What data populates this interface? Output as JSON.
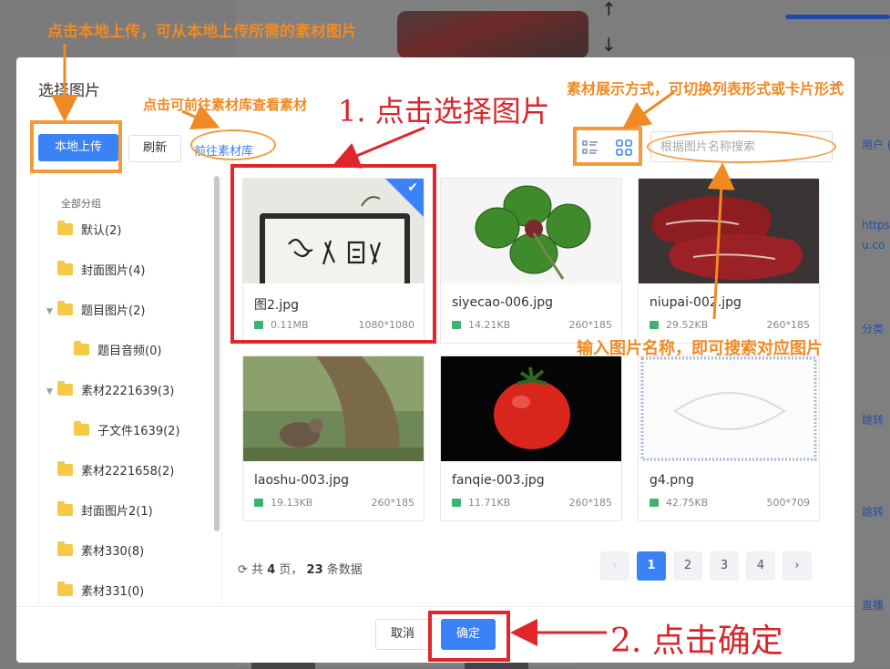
{
  "background": {
    "side_items": [
      "用户 (",
      "https",
      "u.co",
      "分类",
      "跳转",
      "跳转",
      "直播"
    ]
  },
  "modal": {
    "title": "选择图片",
    "close": "×",
    "upload_label": "本地上传",
    "refresh_label": "刷新",
    "library_link": "前往素材库",
    "search_placeholder": "根据图片名称搜索",
    "search_value": "",
    "sidebar": {
      "heading": "全部分组",
      "items": [
        {
          "label": "默认(2)"
        },
        {
          "label": "封面图片(4)"
        },
        {
          "label": "题目图片(2)"
        },
        {
          "label": "题目音频(0)"
        },
        {
          "label": "素材2221639(3)"
        },
        {
          "label": "子文件1639(2)"
        },
        {
          "label": "素材2221658(2)"
        },
        {
          "label": "封面图片2(1)"
        },
        {
          "label": "素材330(8)"
        },
        {
          "label": "素材331(0)"
        }
      ]
    },
    "images": [
      {
        "name": "图2.jpg",
        "size": "0.11MB",
        "dims": "1080*1080",
        "selected": true
      },
      {
        "name": "siyecao-006.jpg",
        "size": "14.21KB",
        "dims": "260*185",
        "selected": false
      },
      {
        "name": "niupai-002.jpg",
        "size": "29.52KB",
        "dims": "260*185",
        "selected": false
      },
      {
        "name": "laoshu-003.jpg",
        "size": "19.13KB",
        "dims": "260*185",
        "selected": false
      },
      {
        "name": "fanqie-003.jpg",
        "size": "11.71KB",
        "dims": "260*185",
        "selected": false
      },
      {
        "name": "g4.png",
        "size": "42.75KB",
        "dims": "500*709",
        "selected": false
      }
    ],
    "pagination": {
      "total_prefix": "共",
      "total_pages": "4",
      "pages_unit": "页，",
      "total_records": "23",
      "records_unit": "条数据",
      "prev": "‹",
      "next": "›",
      "pages": [
        "1",
        "2",
        "3",
        "4"
      ],
      "current": "1"
    },
    "footer": {
      "cancel_label": "取消",
      "ok_label": "确定"
    }
  },
  "annotations": {
    "top_hint": "点击本地上传，可从本地上传所需的素材图片",
    "library_hint": "点击可前往素材库查看素材",
    "step1": "1. 点击选择图片",
    "view_hint": "素材展示方式，可切换列表形式或卡片形式",
    "search_hint": "输入图片名称，即可搜索对应图片",
    "step2": "2. 点击确定"
  },
  "colors": {
    "primary": "#3b82f6",
    "annotation_orange": "#f08a24",
    "annotation_red": "#d7262b"
  }
}
